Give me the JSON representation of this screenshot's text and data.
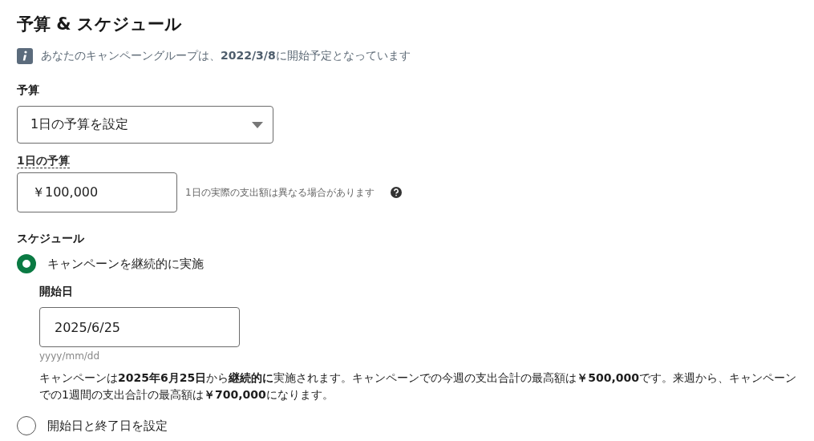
{
  "title": "予算 & スケジュール",
  "notice": {
    "text": "あなたのキャンペーングループは、**2022/3/8**に開始予定となっています"
  },
  "budget": {
    "label": "予算",
    "select": {
      "value": "1日の予算を設定"
    },
    "daily": {
      "label": "1日の予算",
      "value": "￥100,000",
      "hint": "1日の実際の支出額は異なる場合があります"
    }
  },
  "schedule": {
    "label": "スケジュール",
    "options": [
      {
        "label": "キャンペーンを継続的に実施",
        "selected": true,
        "start_date": {
          "label": "開始日",
          "value": "2025/6/25",
          "format": "yyyy/mm/dd"
        },
        "summary": "キャンペーンは**2025年6月25日**から**継続的に**実施されます。キャンペーンでの今週の支出合計の最高額は**￥500,000**です。来週から、キャンペーンでの1週間の支出合計の最高額は**￥700,000**になります。"
      },
      {
        "label": "開始日と終了日を設定",
        "selected": false
      }
    ]
  }
}
